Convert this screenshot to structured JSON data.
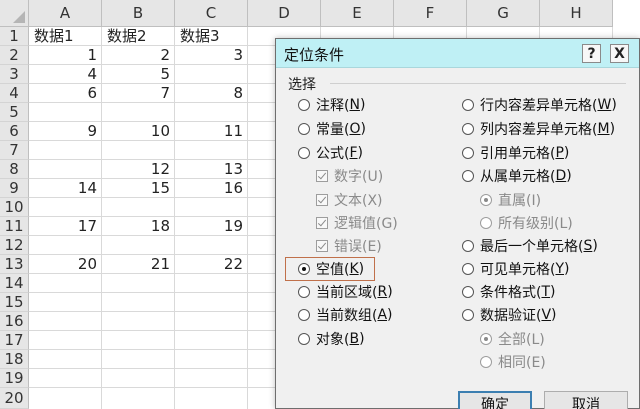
{
  "sheet": {
    "columns": [
      "A",
      "B",
      "C",
      "D",
      "E",
      "F",
      "G",
      "H"
    ],
    "rows": [
      "1",
      "2",
      "3",
      "4",
      "5",
      "6",
      "7",
      "8",
      "9",
      "10",
      "11",
      "12",
      "13",
      "14",
      "15",
      "16",
      "17",
      "18",
      "19",
      "20"
    ],
    "cells": {
      "r1": [
        "数据1",
        "数据2",
        "数据3"
      ],
      "r2": [
        "1",
        "2",
        "3"
      ],
      "r3": [
        "4",
        "5",
        ""
      ],
      "r4": [
        "6",
        "7",
        "8"
      ],
      "r6": [
        "9",
        "10",
        "11"
      ],
      "r8": [
        "",
        "12",
        "13"
      ],
      "r9": [
        "14",
        "15",
        "16"
      ],
      "r11": [
        "17",
        "18",
        "19"
      ],
      "r13": [
        "20",
        "21",
        "22"
      ]
    }
  },
  "dialog": {
    "title": "定位条件",
    "help_label": "?",
    "close_label": "X",
    "group_label": "选择",
    "left_options": [
      {
        "text": "注释(",
        "key": "N",
        "tail": ")"
      },
      {
        "text": "常量(",
        "key": "O",
        "tail": ")"
      },
      {
        "text": "公式(",
        "key": "F",
        "tail": ")"
      },
      {
        "text": "数字(U)"
      },
      {
        "text": "文本(X)"
      },
      {
        "text": "逻辑值(G)"
      },
      {
        "text": "错误(E)"
      },
      {
        "text": "空值(",
        "key": "K",
        "tail": ")"
      },
      {
        "text": "当前区域(",
        "key": "R",
        "tail": ")"
      },
      {
        "text": "当前数组(",
        "key": "A",
        "tail": ")"
      },
      {
        "text": "对象(",
        "key": "B",
        "tail": ")"
      }
    ],
    "right_options": [
      {
        "text": "行内容差异单元格(",
        "key": "W",
        "tail": ")"
      },
      {
        "text": "列内容差异单元格(",
        "key": "M",
        "tail": ")"
      },
      {
        "text": "引用单元格(",
        "key": "P",
        "tail": ")"
      },
      {
        "text": "从属单元格(",
        "key": "D",
        "tail": ")"
      },
      {
        "text": "直属(I)"
      },
      {
        "text": "所有级别(L)"
      },
      {
        "text": "最后一个单元格(",
        "key": "S",
        "tail": ")"
      },
      {
        "text": "可见单元格(",
        "key": "Y",
        "tail": ")"
      },
      {
        "text": "条件格式(",
        "key": "T",
        "tail": ")"
      },
      {
        "text": "数据验证(",
        "key": "V",
        "tail": ")"
      },
      {
        "text": "全部(L)"
      },
      {
        "text": "相同(E)"
      }
    ],
    "ok_label": "确定",
    "cancel_label": "取消",
    "colors": {
      "titlebar": "#bff0f5",
      "highlight": "#c0704a",
      "primary_border": "#3c7fb1"
    }
  }
}
